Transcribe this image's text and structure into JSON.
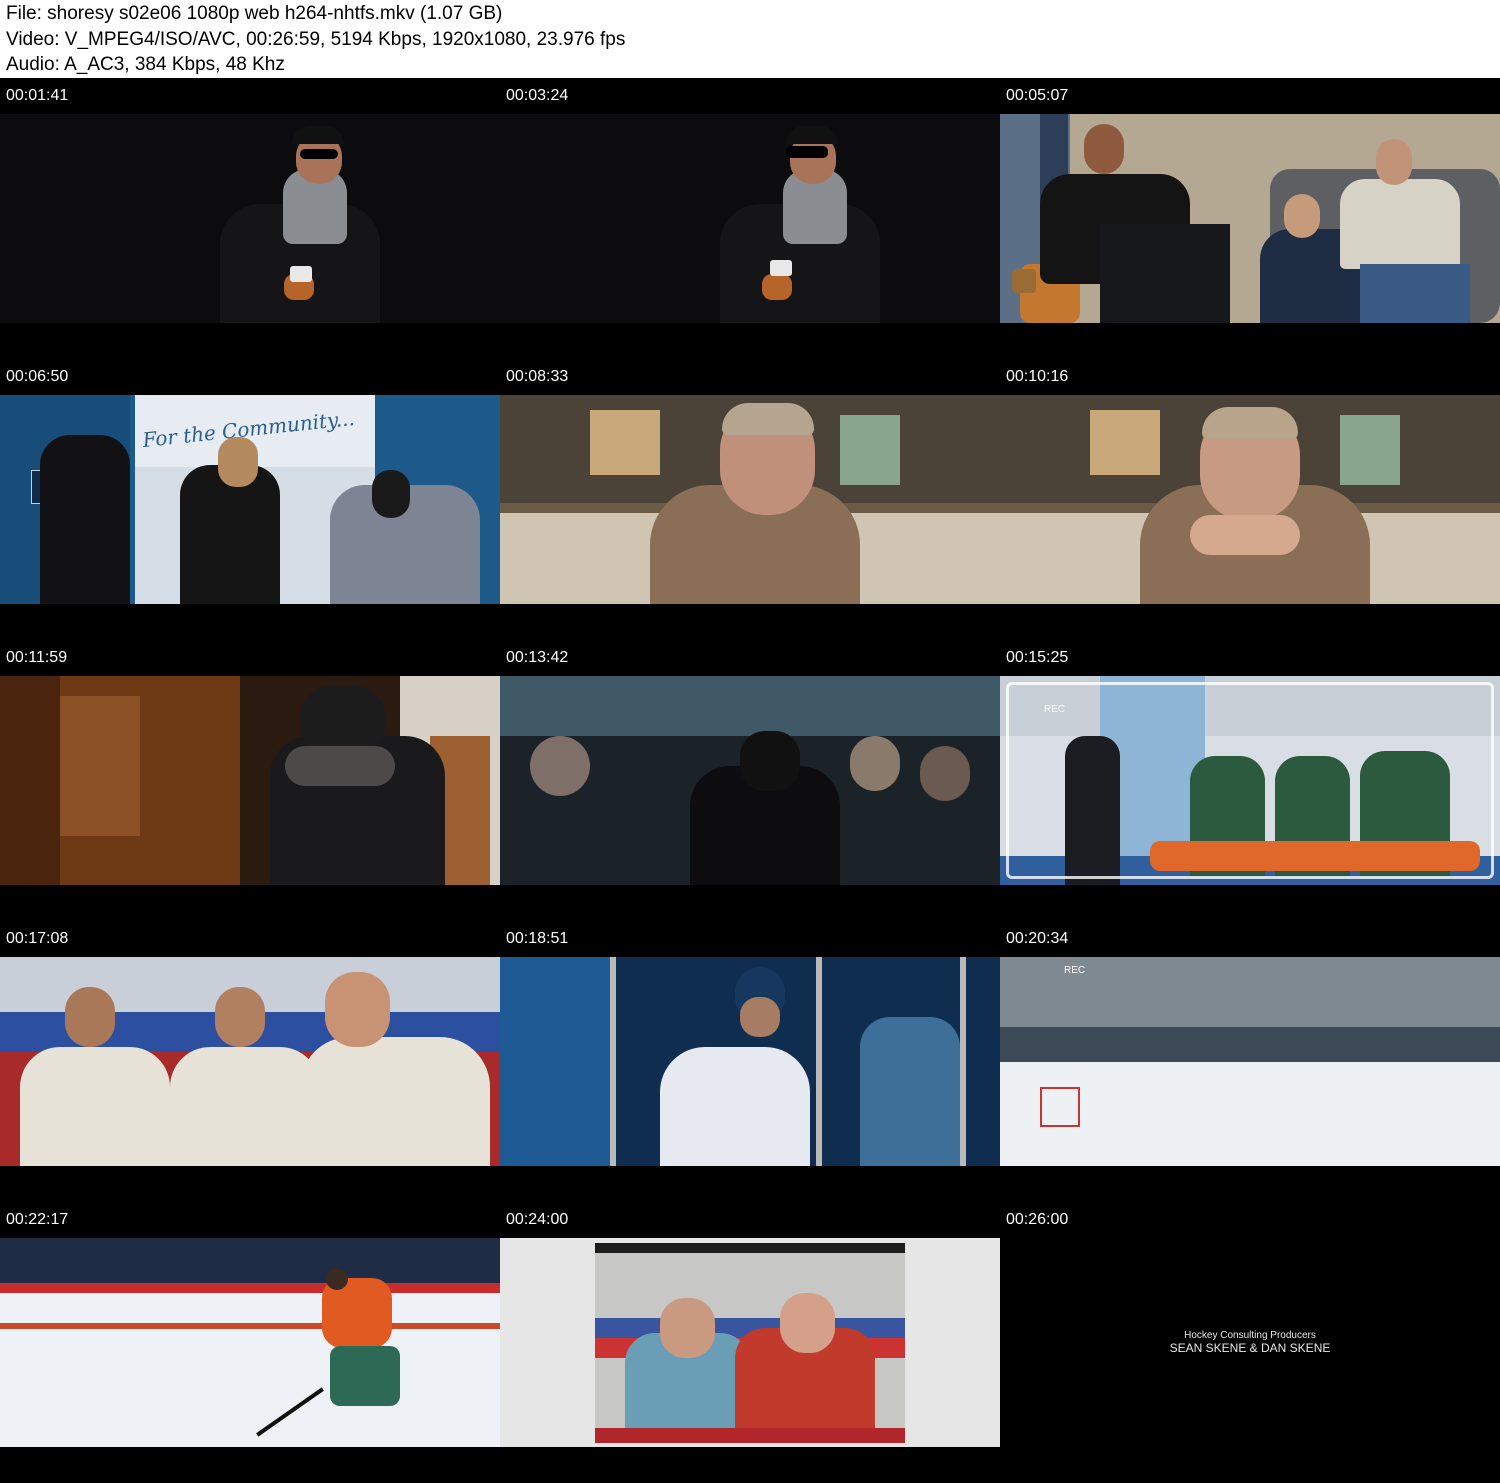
{
  "header": {
    "file": "File: shoresy s02e06 1080p web h264-nhtfs.mkv (1.07 GB)",
    "video": "Video: V_MPEG4/ISO/AVC, 00:26:59, 5194 Kbps, 1920x1080, 23.976 fps",
    "audio": "Audio: A_AC3, 384 Kbps, 48 Khz"
  },
  "thumbnails": [
    {
      "timestamp": "00:01:41"
    },
    {
      "timestamp": "00:03:24"
    },
    {
      "timestamp": "00:05:07"
    },
    {
      "timestamp": "00:06:50",
      "sign_text": "For the Community..."
    },
    {
      "timestamp": "00:08:33"
    },
    {
      "timestamp": "00:10:16"
    },
    {
      "timestamp": "00:11:59"
    },
    {
      "timestamp": "00:13:42"
    },
    {
      "timestamp": "00:15:25",
      "rec_text": "REC"
    },
    {
      "timestamp": "00:17:08"
    },
    {
      "timestamp": "00:18:51"
    },
    {
      "timestamp": "00:20:34",
      "rec_text": "REC"
    },
    {
      "timestamp": "00:22:17"
    },
    {
      "timestamp": "00:24:00"
    },
    {
      "timestamp": "00:26:00",
      "credit_line1": "Hockey Consulting Producers",
      "credit_line2": "SEAN SKENE & DAN SKENE"
    }
  ],
  "colors": {
    "header_bg": "#ffffff",
    "page_bg": "#000000",
    "timestamp_text": "#ffffff"
  }
}
